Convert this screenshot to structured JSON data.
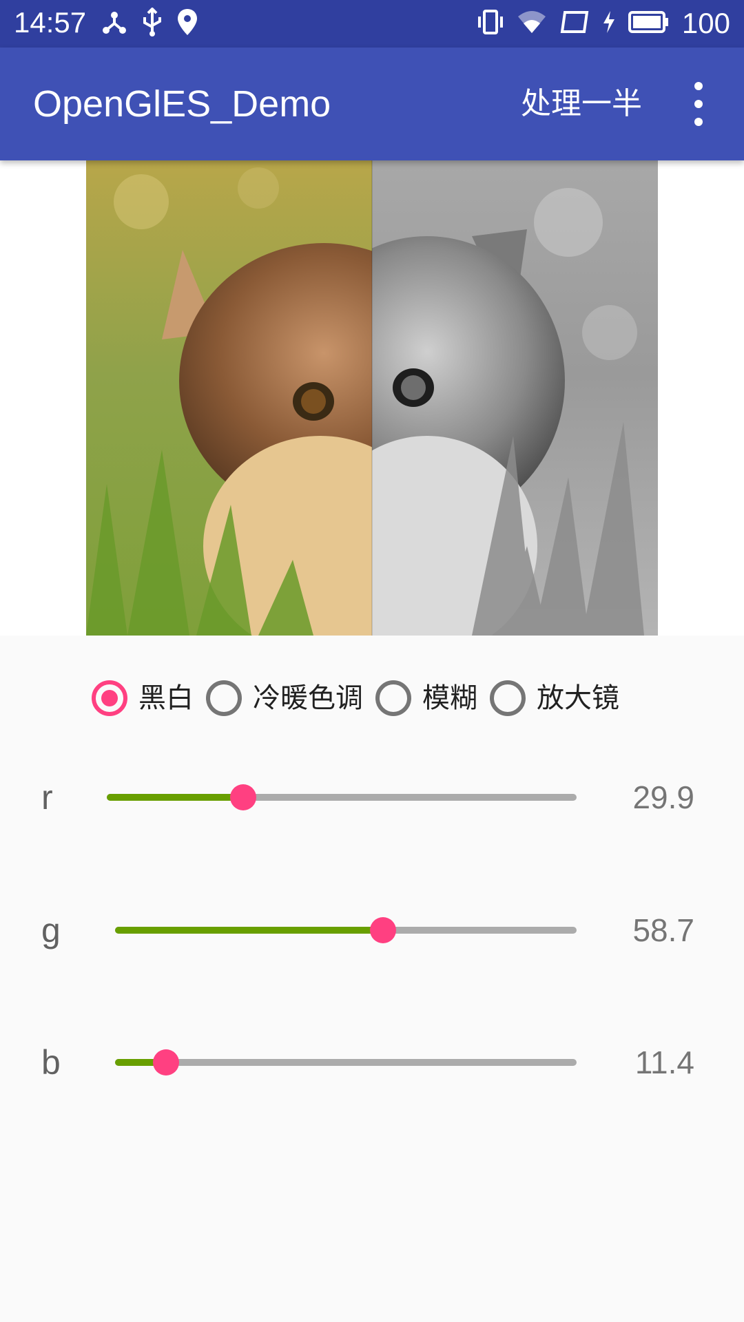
{
  "status_bar": {
    "time": "14:57",
    "left_icons": [
      "share-icon",
      "usb-icon",
      "location-icon"
    ],
    "right_icons": [
      "vibrate-icon",
      "wifi-icon",
      "tablet-icon",
      "charging-icon",
      "battery-icon"
    ],
    "battery_percent": "100"
  },
  "app_bar": {
    "title": "OpenGlES_Demo",
    "action_label": "处理一半",
    "overflow_icon": "more-vert-icon",
    "color": "#3f51b5"
  },
  "preview": {
    "image": "kitten-photo",
    "mode": "half processed (left color, right grayscale)"
  },
  "filters": {
    "options": [
      {
        "label": "黑白",
        "checked": true
      },
      {
        "label": "冷暖色调",
        "checked": false
      },
      {
        "label": "模糊",
        "checked": false
      },
      {
        "label": "放大镜",
        "checked": false
      }
    ]
  },
  "sliders": [
    {
      "label": "r",
      "value": "29.9",
      "fraction": 0.29
    },
    {
      "label": "g",
      "value": "58.7",
      "fraction": 0.58
    },
    {
      "label": "b",
      "value": "11.4",
      "fraction": 0.11
    }
  ],
  "colors": {
    "accent": "#ff4081",
    "progress": "#689f00",
    "track": "#ababab",
    "status_bar": "#303f9f"
  }
}
